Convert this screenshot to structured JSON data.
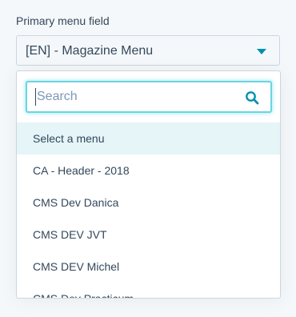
{
  "field": {
    "label": "Primary menu field",
    "selected_value": "[EN] - Magazine Menu"
  },
  "search": {
    "placeholder": "Search",
    "value": ""
  },
  "options": [
    {
      "label": "Select a menu",
      "highlighted": true
    },
    {
      "label": "CA - Header - 2018",
      "highlighted": false
    },
    {
      "label": "CMS Dev Danica",
      "highlighted": false
    },
    {
      "label": "CMS DEV JVT",
      "highlighted": false
    },
    {
      "label": "CMS DEV Michel",
      "highlighted": false
    },
    {
      "label": "CMS Dev Practicum",
      "highlighted": false
    }
  ],
  "icons": {
    "caret": "chevron-down-icon",
    "search": "search-icon"
  },
  "colors": {
    "accent": "#0091ae",
    "text": "#33475b",
    "highlight": "#e5f5f8",
    "focus_border": "#6fd3e0"
  }
}
